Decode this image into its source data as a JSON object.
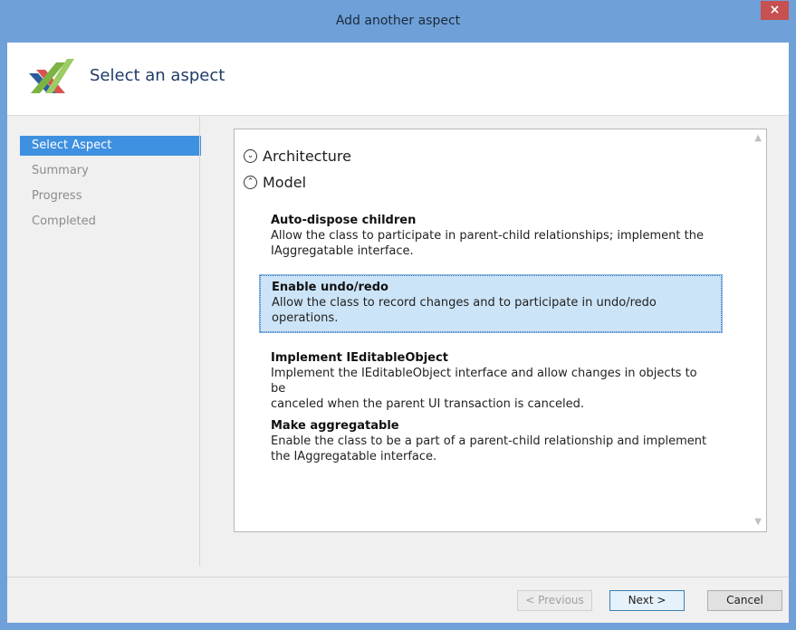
{
  "window": {
    "title": "Add another aspect",
    "close_glyph": "×"
  },
  "header": {
    "title": "Select an aspect",
    "logo_icon": "postsharp-logo-icon"
  },
  "sidebar": {
    "items": [
      {
        "label": "Select Aspect",
        "active": true
      },
      {
        "label": "Summary",
        "active": false
      },
      {
        "label": "Progress",
        "active": false
      },
      {
        "label": "Completed",
        "active": false
      }
    ]
  },
  "groups": {
    "architecture": {
      "label": "Architecture",
      "icon": "chevron-down-circle-icon",
      "glyph": "⌄"
    },
    "model": {
      "label": "Model",
      "icon": "chevron-up-circle-icon",
      "glyph": "⌃"
    }
  },
  "aspects": [
    {
      "name": "Auto-dispose children",
      "desc_line1": "Allow the class to participate in parent-child relationships; implement the",
      "desc_line2": "IAggregatable interface."
    },
    {
      "name": "Enable undo/redo",
      "desc_line1": "Allow the class to record changes and to participate in undo/redo",
      "desc_line2": "operations."
    },
    {
      "name": "Implement IEditableObject",
      "desc_line1": "Implement the IEditableObject interface and allow changes in objects to be",
      "desc_line2": "canceled when the parent UI transaction is canceled."
    },
    {
      "name": "Make aggregatable",
      "desc_line1": "Enable the class to be a part of a parent-child relationship and implement",
      "desc_line2": "the IAggregatable interface."
    }
  ],
  "buttons": {
    "previous": "< Previous",
    "next": "Next >",
    "cancel": "Cancel"
  },
  "colors": {
    "accent": "#3e90e0",
    "selection": "#cce4f7",
    "titlebar": "#6fa0d8"
  }
}
